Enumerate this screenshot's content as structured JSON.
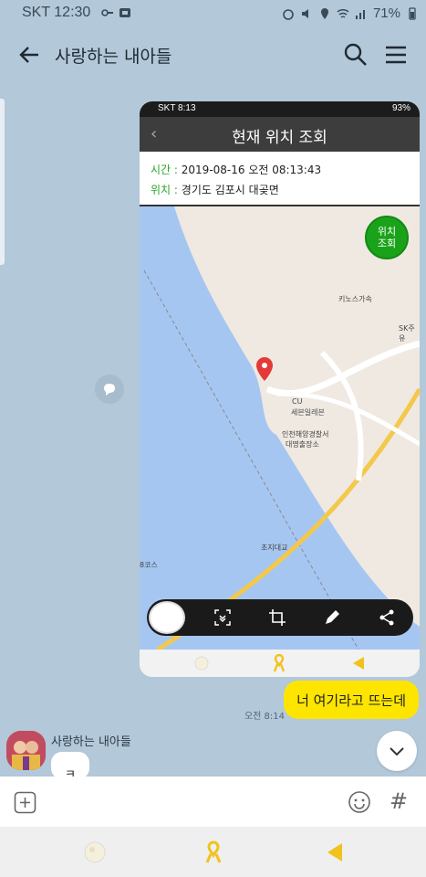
{
  "statusbar": {
    "carrier_time": "SKT 12:30",
    "battery": "71%"
  },
  "header": {
    "title": "사랑하는 내아들"
  },
  "shared_image": {
    "status_time": "SKT 8:13",
    "status_battery": "93%",
    "title": "현재 위치 조회",
    "time_label": "시간 :",
    "time_value": "2019-08-16 오전 08:13:43",
    "location_label": "위치 :",
    "location_value": "경기도 김포시 대곶면",
    "locate_button": "위치\n조회",
    "map_labels": {
      "poi1": "키노스가속",
      "poi2": "SK주유",
      "poi3": "CU",
      "poi4": "세븐일레븐",
      "poi5": "인천해양경찰서",
      "poi6": "대명출장소",
      "poi7": "초지대교",
      "poi8": "8코스"
    }
  },
  "messages": {
    "mine_text": "너 여기라고 뜨는데",
    "mine_time": "오전 8:14",
    "sender_name": "사랑하는 내아들",
    "theirs_text": "ㅋ"
  },
  "input": {
    "placeholder": ""
  },
  "colors": {
    "chat_bg": "#b3c8d9",
    "my_bubble": "#fee500",
    "accent_green": "#1aa31a"
  }
}
